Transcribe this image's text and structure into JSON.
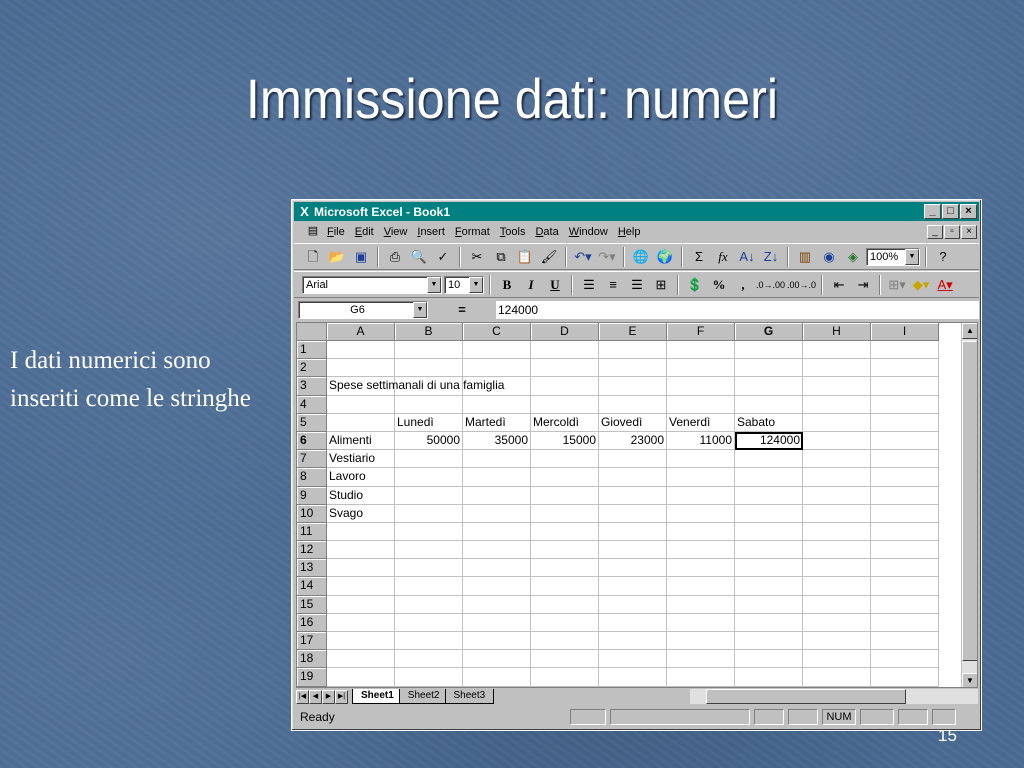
{
  "slide": {
    "title": "Immissione dati: numeri",
    "side_text": "I dati numerici sono inseriti come le stringhe",
    "page_number": "15"
  },
  "window": {
    "title": "Microsoft Excel - Book1",
    "controls": [
      "_",
      "□",
      "×"
    ]
  },
  "menu": {
    "items": [
      "File",
      "Edit",
      "View",
      "Insert",
      "Format",
      "Tools",
      "Data",
      "Window",
      "Help"
    ],
    "doc_controls": [
      "_",
      "▫",
      "×"
    ]
  },
  "toolbar_standard": {
    "icons": [
      "new-icon",
      "open-icon",
      "save-icon",
      "print-icon",
      "print-preview-icon",
      "spelling-icon",
      "cut-icon",
      "copy-icon",
      "paste-icon",
      "format-painter-icon",
      "undo-icon",
      "redo-icon",
      "hyperlink-icon",
      "web-toolbar-icon",
      "autosum-icon",
      "function-icon",
      "sort-ascending-icon",
      "sort-descending-icon",
      "chart-wizard-icon",
      "map-icon",
      "drawing-icon",
      "help-icon"
    ],
    "zoom": "100%"
  },
  "toolbar_format": {
    "font": "Arial",
    "size": "10",
    "bold": "B",
    "italic": "I",
    "underline": "U",
    "currency": "%",
    "comma": ","
  },
  "formula_bar": {
    "name_box": "G6",
    "equals": "=",
    "value": "124000"
  },
  "sheet": {
    "columns": [
      "A",
      "B",
      "C",
      "D",
      "E",
      "F",
      "G",
      "H",
      "I"
    ],
    "active_column": "G",
    "active_row": "6",
    "rows": [
      {
        "n": "1",
        "cells": [
          "",
          "",
          "",
          "",
          "",
          "",
          "",
          "",
          ""
        ]
      },
      {
        "n": "2",
        "cells": [
          "",
          "",
          "",
          "",
          "",
          "",
          "",
          "",
          ""
        ]
      },
      {
        "n": "3",
        "cells": [
          "Spese settimanali di una famiglia",
          "",
          "",
          "",
          "",
          "",
          "",
          "",
          ""
        ]
      },
      {
        "n": "4",
        "cells": [
          "",
          "",
          "",
          "",
          "",
          "",
          "",
          "",
          ""
        ]
      },
      {
        "n": "5",
        "cells": [
          "",
          "Lunedì",
          "Martedì",
          "Mercoldì",
          "Giovedì",
          "Venerdì",
          "Sabato",
          "",
          ""
        ]
      },
      {
        "n": "6",
        "cells": [
          "Alimenti",
          "50000",
          "35000",
          "15000",
          "23000",
          "11000",
          "124000",
          "",
          ""
        ]
      },
      {
        "n": "7",
        "cells": [
          "Vestiario",
          "",
          "",
          "",
          "",
          "",
          "",
          "",
          ""
        ]
      },
      {
        "n": "8",
        "cells": [
          "Lavoro",
          "",
          "",
          "",
          "",
          "",
          "",
          "",
          ""
        ]
      },
      {
        "n": "9",
        "cells": [
          "Studio",
          "",
          "",
          "",
          "",
          "",
          "",
          "",
          ""
        ]
      },
      {
        "n": "10",
        "cells": [
          "Svago",
          "",
          "",
          "",
          "",
          "",
          "",
          "",
          ""
        ]
      },
      {
        "n": "11",
        "cells": [
          "",
          "",
          "",
          "",
          "",
          "",
          "",
          "",
          ""
        ]
      },
      {
        "n": "12",
        "cells": [
          "",
          "",
          "",
          "",
          "",
          "",
          "",
          "",
          ""
        ]
      },
      {
        "n": "13",
        "cells": [
          "",
          "",
          "",
          "",
          "",
          "",
          "",
          "",
          ""
        ]
      },
      {
        "n": "14",
        "cells": [
          "",
          "",
          "",
          "",
          "",
          "",
          "",
          "",
          ""
        ]
      },
      {
        "n": "15",
        "cells": [
          "",
          "",
          "",
          "",
          "",
          "",
          "",
          "",
          ""
        ]
      },
      {
        "n": "16",
        "cells": [
          "",
          "",
          "",
          "",
          "",
          "",
          "",
          "",
          ""
        ]
      },
      {
        "n": "17",
        "cells": [
          "",
          "",
          "",
          "",
          "",
          "",
          "",
          "",
          ""
        ]
      },
      {
        "n": "18",
        "cells": [
          "",
          "",
          "",
          "",
          "",
          "",
          "",
          "",
          ""
        ]
      },
      {
        "n": "19",
        "cells": [
          "",
          "",
          "",
          "",
          "",
          "",
          "",
          "",
          ""
        ]
      }
    ],
    "numeric_rows": [
      "6"
    ]
  },
  "tabs": [
    "Sheet1",
    "Sheet2",
    "Sheet3"
  ],
  "status": {
    "text": "Ready",
    "num": "NUM"
  }
}
